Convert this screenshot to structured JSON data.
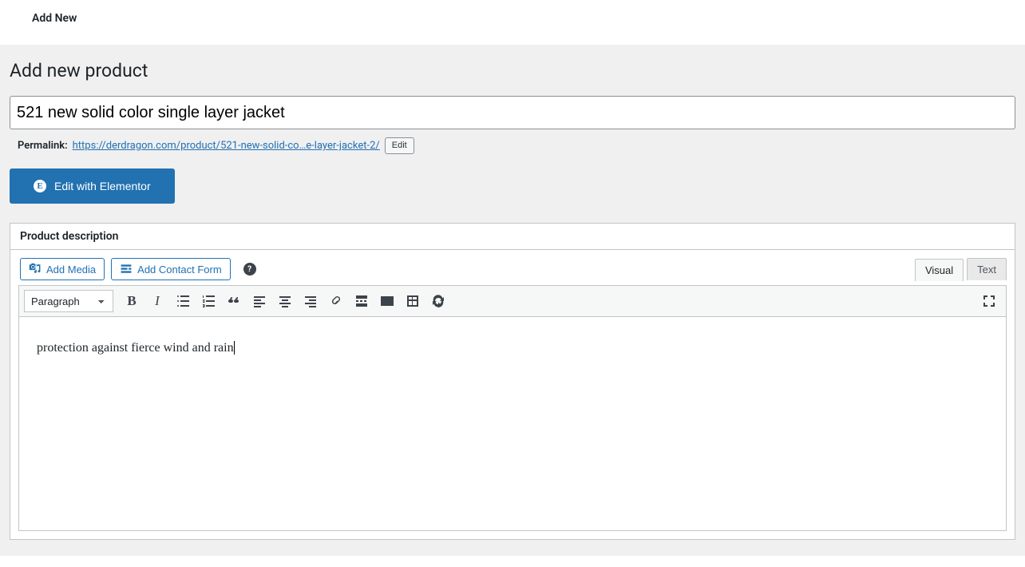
{
  "topbar": {
    "add_new": "Add New"
  },
  "page": {
    "title": "Add new product",
    "product_title": "521 new solid color single layer jacket"
  },
  "permalink": {
    "label": "Permalink:",
    "base": "https://derdragon.com/product/",
    "slug": "521-new-solid-co…e-layer-jacket-2/",
    "edit_label": "Edit"
  },
  "elementor": {
    "button_label": "Edit with Elementor"
  },
  "postbox": {
    "header": "Product description"
  },
  "media": {
    "add_media": "Add Media",
    "add_contact_form": "Add Contact Form"
  },
  "tabs": {
    "visual": "Visual",
    "text": "Text"
  },
  "toolbar": {
    "format_options": [
      "Paragraph"
    ],
    "format_value": "Paragraph"
  },
  "editor": {
    "content": "protection against fierce wind and rain"
  }
}
